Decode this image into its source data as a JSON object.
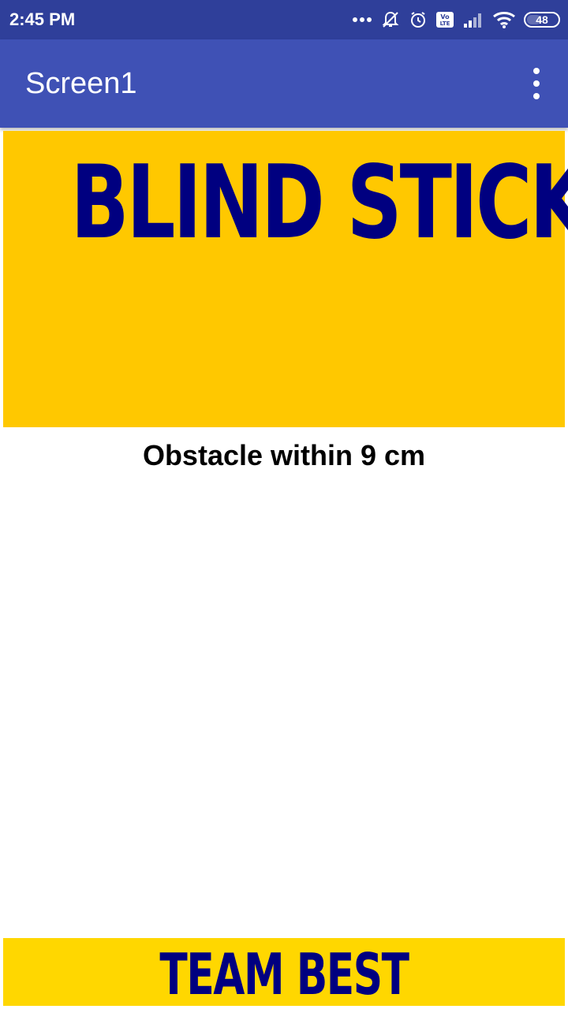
{
  "status_bar": {
    "time": "2:45 PM",
    "battery_level": "48",
    "icons": [
      "more-dots-icon",
      "notifications-off-icon",
      "alarm-icon",
      "volte-icon",
      "signal-icon",
      "wifi-icon",
      "battery-icon"
    ]
  },
  "app_bar": {
    "title": "Screen1",
    "menu_icon": "overflow-menu-icon"
  },
  "banner": {
    "title": "BLIND STICK",
    "background": "#ffc800",
    "text_color": "#000080"
  },
  "main": {
    "distance_text": "Obstacle within 9 cm"
  },
  "footer": {
    "text": "TEAM BEST",
    "background": "#ffd700",
    "text_color": "#000080"
  },
  "colors": {
    "status_bar": "#2f3f9a",
    "app_bar": "#3f51b5"
  }
}
